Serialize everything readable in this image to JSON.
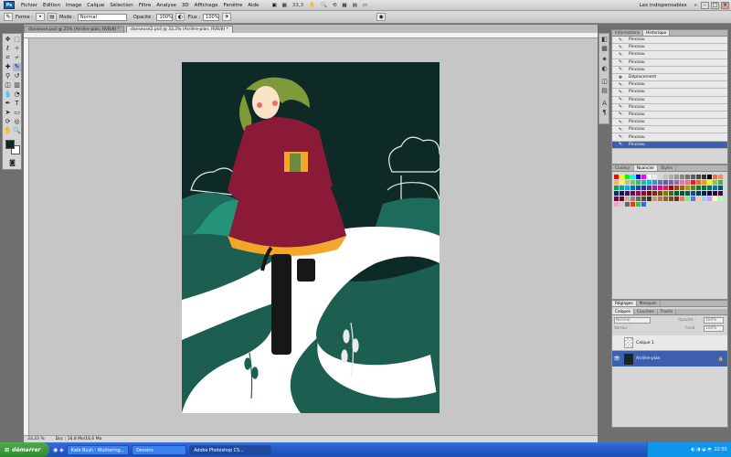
{
  "menubar": {
    "logo": "Ps",
    "items": [
      "Fichier",
      "Edition",
      "Image",
      "Calque",
      "Sélection",
      "Filtre",
      "Analyse",
      "3D",
      "Affichage",
      "Fenêtre",
      "Aide"
    ],
    "zoom": "33,3",
    "workspace": "Les indispensables"
  },
  "options": {
    "forme_label": "Forme :",
    "mode_label": "Mode :",
    "mode_value": "Normal",
    "opacite_label": "Opacité :",
    "opacite_value": "100%",
    "flux_label": "Flux :",
    "flux_value": "100%"
  },
  "tabs": [
    {
      "label": "danseuse.psd @ 25% (Arrière-plan, RVB/8) *"
    },
    {
      "label": "danseuse2.psd @ 33,3% (Arrière-plan, RVB/8) *"
    }
  ],
  "status": {
    "zoom": "33,33 %",
    "doc": "Doc : 16,8 Mo/16,6 Mo"
  },
  "history": {
    "tabs": [
      "Informations",
      "Historique"
    ],
    "items": [
      "Pinceau",
      "Pinceau",
      "Pinceau",
      "Pinceau",
      "Pinceau",
      "Déplacement",
      "Pinceau",
      "Pinceau",
      "Pinceau",
      "Pinceau",
      "Pinceau",
      "Pinceau",
      "Pinceau",
      "Pinceau",
      "Pinceau"
    ],
    "selected_index": 14
  },
  "swatches_panel": {
    "tabs": [
      "Couleur",
      "Nuancier",
      "Styles"
    ],
    "colors": [
      "#ff0000",
      "#ffff00",
      "#00ff00",
      "#00ffff",
      "#0000ff",
      "#ff00ff",
      "#ffffff",
      "#ebebeb",
      "#d6d6d6",
      "#c2c2c2",
      "#adadad",
      "#999999",
      "#858585",
      "#707070",
      "#5c5c5c",
      "#474747",
      "#333333",
      "#000000",
      "#f26c4f",
      "#f68e55",
      "#fbaf5c",
      "#fff467",
      "#acd372",
      "#7cc576",
      "#3bb878",
      "#1abbb4",
      "#00bff3",
      "#438ccb",
      "#5574b9",
      "#605ca8",
      "#855fa8",
      "#a763a8",
      "#f06ea9",
      "#f26d7d",
      "#ed1c24",
      "#f26522",
      "#f7941d",
      "#fff200",
      "#8dc73f",
      "#39b54a",
      "#00a651",
      "#00a99d",
      "#00aeef",
      "#0072bc",
      "#0054a6",
      "#2e3192",
      "#662d91",
      "#92278f",
      "#ec008c",
      "#ed145b",
      "#9e0b0f",
      "#a0410d",
      "#a36209",
      "#aba000",
      "#598527",
      "#1a7b30",
      "#007236",
      "#00746b",
      "#0076a3",
      "#004b80",
      "#003471",
      "#1b1464",
      "#440e62",
      "#630460",
      "#9e005d",
      "#9e0039",
      "#790000",
      "#7b2e00",
      "#7d4900",
      "#827b00",
      "#406618",
      "#005e20",
      "#005826",
      "#005952",
      "#005b7f",
      "#003663",
      "#002157",
      "#0d004c",
      "#32004b",
      "#4b0049",
      "#7b0046",
      "#7a0026",
      "#c7b299",
      "#998675",
      "#736357",
      "#534741",
      "#37302d",
      "#c69c6d",
      "#a67c52",
      "#8c6239",
      "#754c24",
      "#603913",
      "#ff6666",
      "#66ff66",
      "#6666ff",
      "#ffcc99",
      "#99ccff",
      "#cc99ff",
      "#ffff99",
      "#99ffcc",
      "#ff99cc",
      "#cccccc",
      "#666666",
      "#ff3300",
      "#33cc33",
      "#3366ff"
    ]
  },
  "layers": {
    "tabs": [
      "Réglages",
      "Masques"
    ],
    "tabs2": [
      "Calques",
      "Couches",
      "Tracés"
    ],
    "blend": "Normal",
    "opacity_label": "Opacité :",
    "opacity_value": "100%",
    "lock_label": "Verrou :",
    "fill_label": "Fond :",
    "fill_value": "100%",
    "items": [
      {
        "name": "Calque 1",
        "selected": false
      },
      {
        "name": "Arrière-plan",
        "selected": true
      }
    ]
  },
  "taskbar": {
    "start": "démarrer",
    "tasks": [
      {
        "label": "Kate Bush - Wuthering...",
        "active": false
      },
      {
        "label": "Dessins",
        "active": false
      },
      {
        "label": "Adobe Photoshop CS...",
        "active": true
      }
    ],
    "clock": "22:55"
  }
}
